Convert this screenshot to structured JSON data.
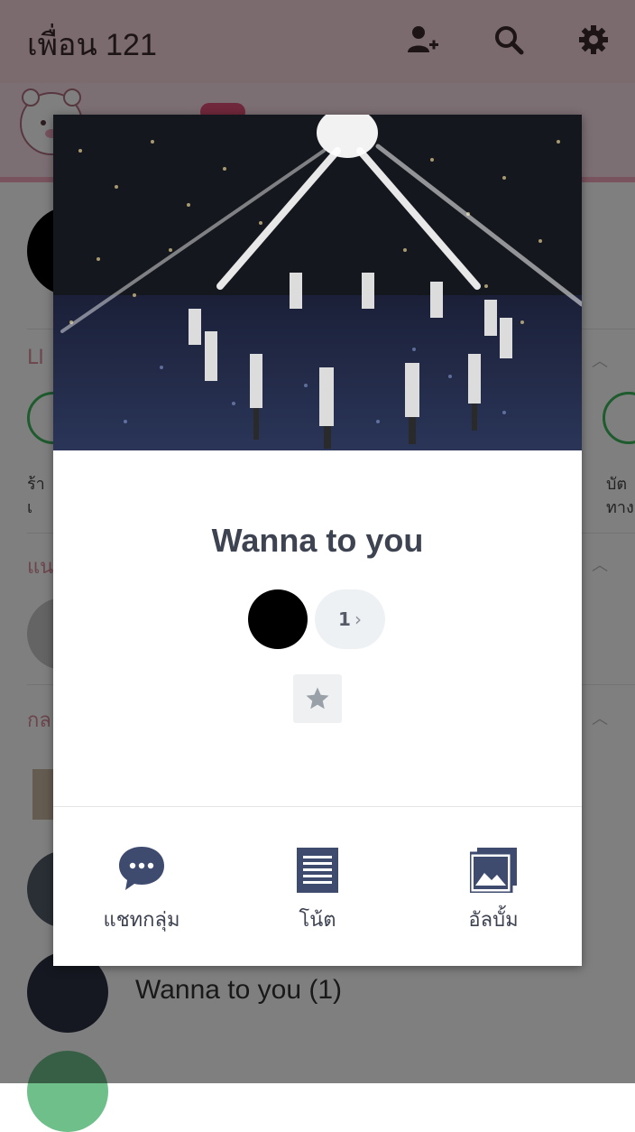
{
  "header": {
    "title": "เพื่อน 121"
  },
  "background_list": {
    "sections": [
      {
        "label": "LI"
      },
      {
        "label": "แน"
      },
      {
        "label": "กล"
      }
    ],
    "left_item_label": "ร้า\nเ",
    "right_item_label": "บัต\nทาง",
    "rows": [
      {
        "label": "Wanna to you (1)"
      }
    ]
  },
  "modal": {
    "group_name": "Wanna to you",
    "member_count": "1",
    "actions": [
      {
        "label": "แชทกลุ่ม",
        "icon": "chat-bubble-icon"
      },
      {
        "label": "โน้ต",
        "icon": "note-icon"
      },
      {
        "label": "อัลบั้ม",
        "icon": "album-icon"
      }
    ]
  },
  "colors": {
    "header_bg": "#f6d4dd",
    "accent_pink": "#e05078",
    "icon_navy": "#3e4a6e",
    "title_text": "#3e4352"
  }
}
